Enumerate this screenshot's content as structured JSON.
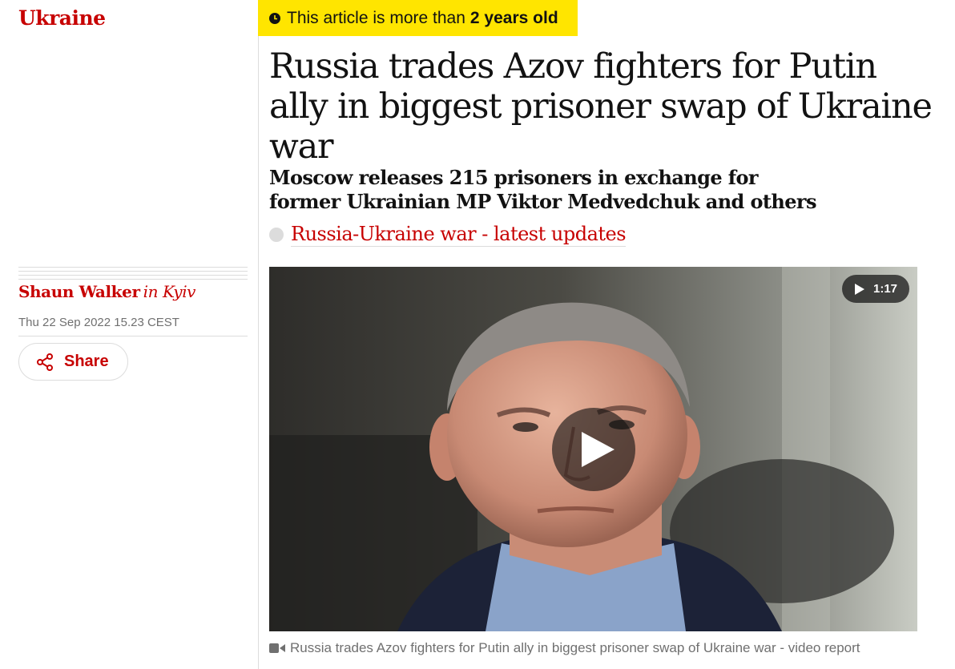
{
  "section": {
    "title": "Ukraine"
  },
  "age_badge": {
    "prefix": "This article is more than",
    "age": "2 years old",
    "icon": "clock-icon"
  },
  "headline": "Russia trades Azov fighters for Putin ally in biggest prisoner swap of Ukraine war",
  "standfirst": "Moscow releases 215 prisoners in exchange for former Ukrainian MP Viktor Medvedchuk and others",
  "live_link": {
    "label": "Russia-Ukraine war - latest updates"
  },
  "byline": {
    "author": "Shaun Walker",
    "location": "in Kyiv"
  },
  "dateline": "Thu 22 Sep 2022 15.23 CEST",
  "share": {
    "label": "Share",
    "icon": "share-icon"
  },
  "video": {
    "duration": "1:17",
    "play_icon": "play-icon"
  },
  "caption": {
    "text": "Russia trades Azov fighters for Putin ally in biggest prisoner swap of Ukraine war - video report",
    "icon": "video-camera-icon"
  },
  "colors": {
    "brand_red": "#c70000",
    "badge_yellow": "#ffe500",
    "rule_gray": "#dcdcdc",
    "meta_gray": "#707070"
  }
}
